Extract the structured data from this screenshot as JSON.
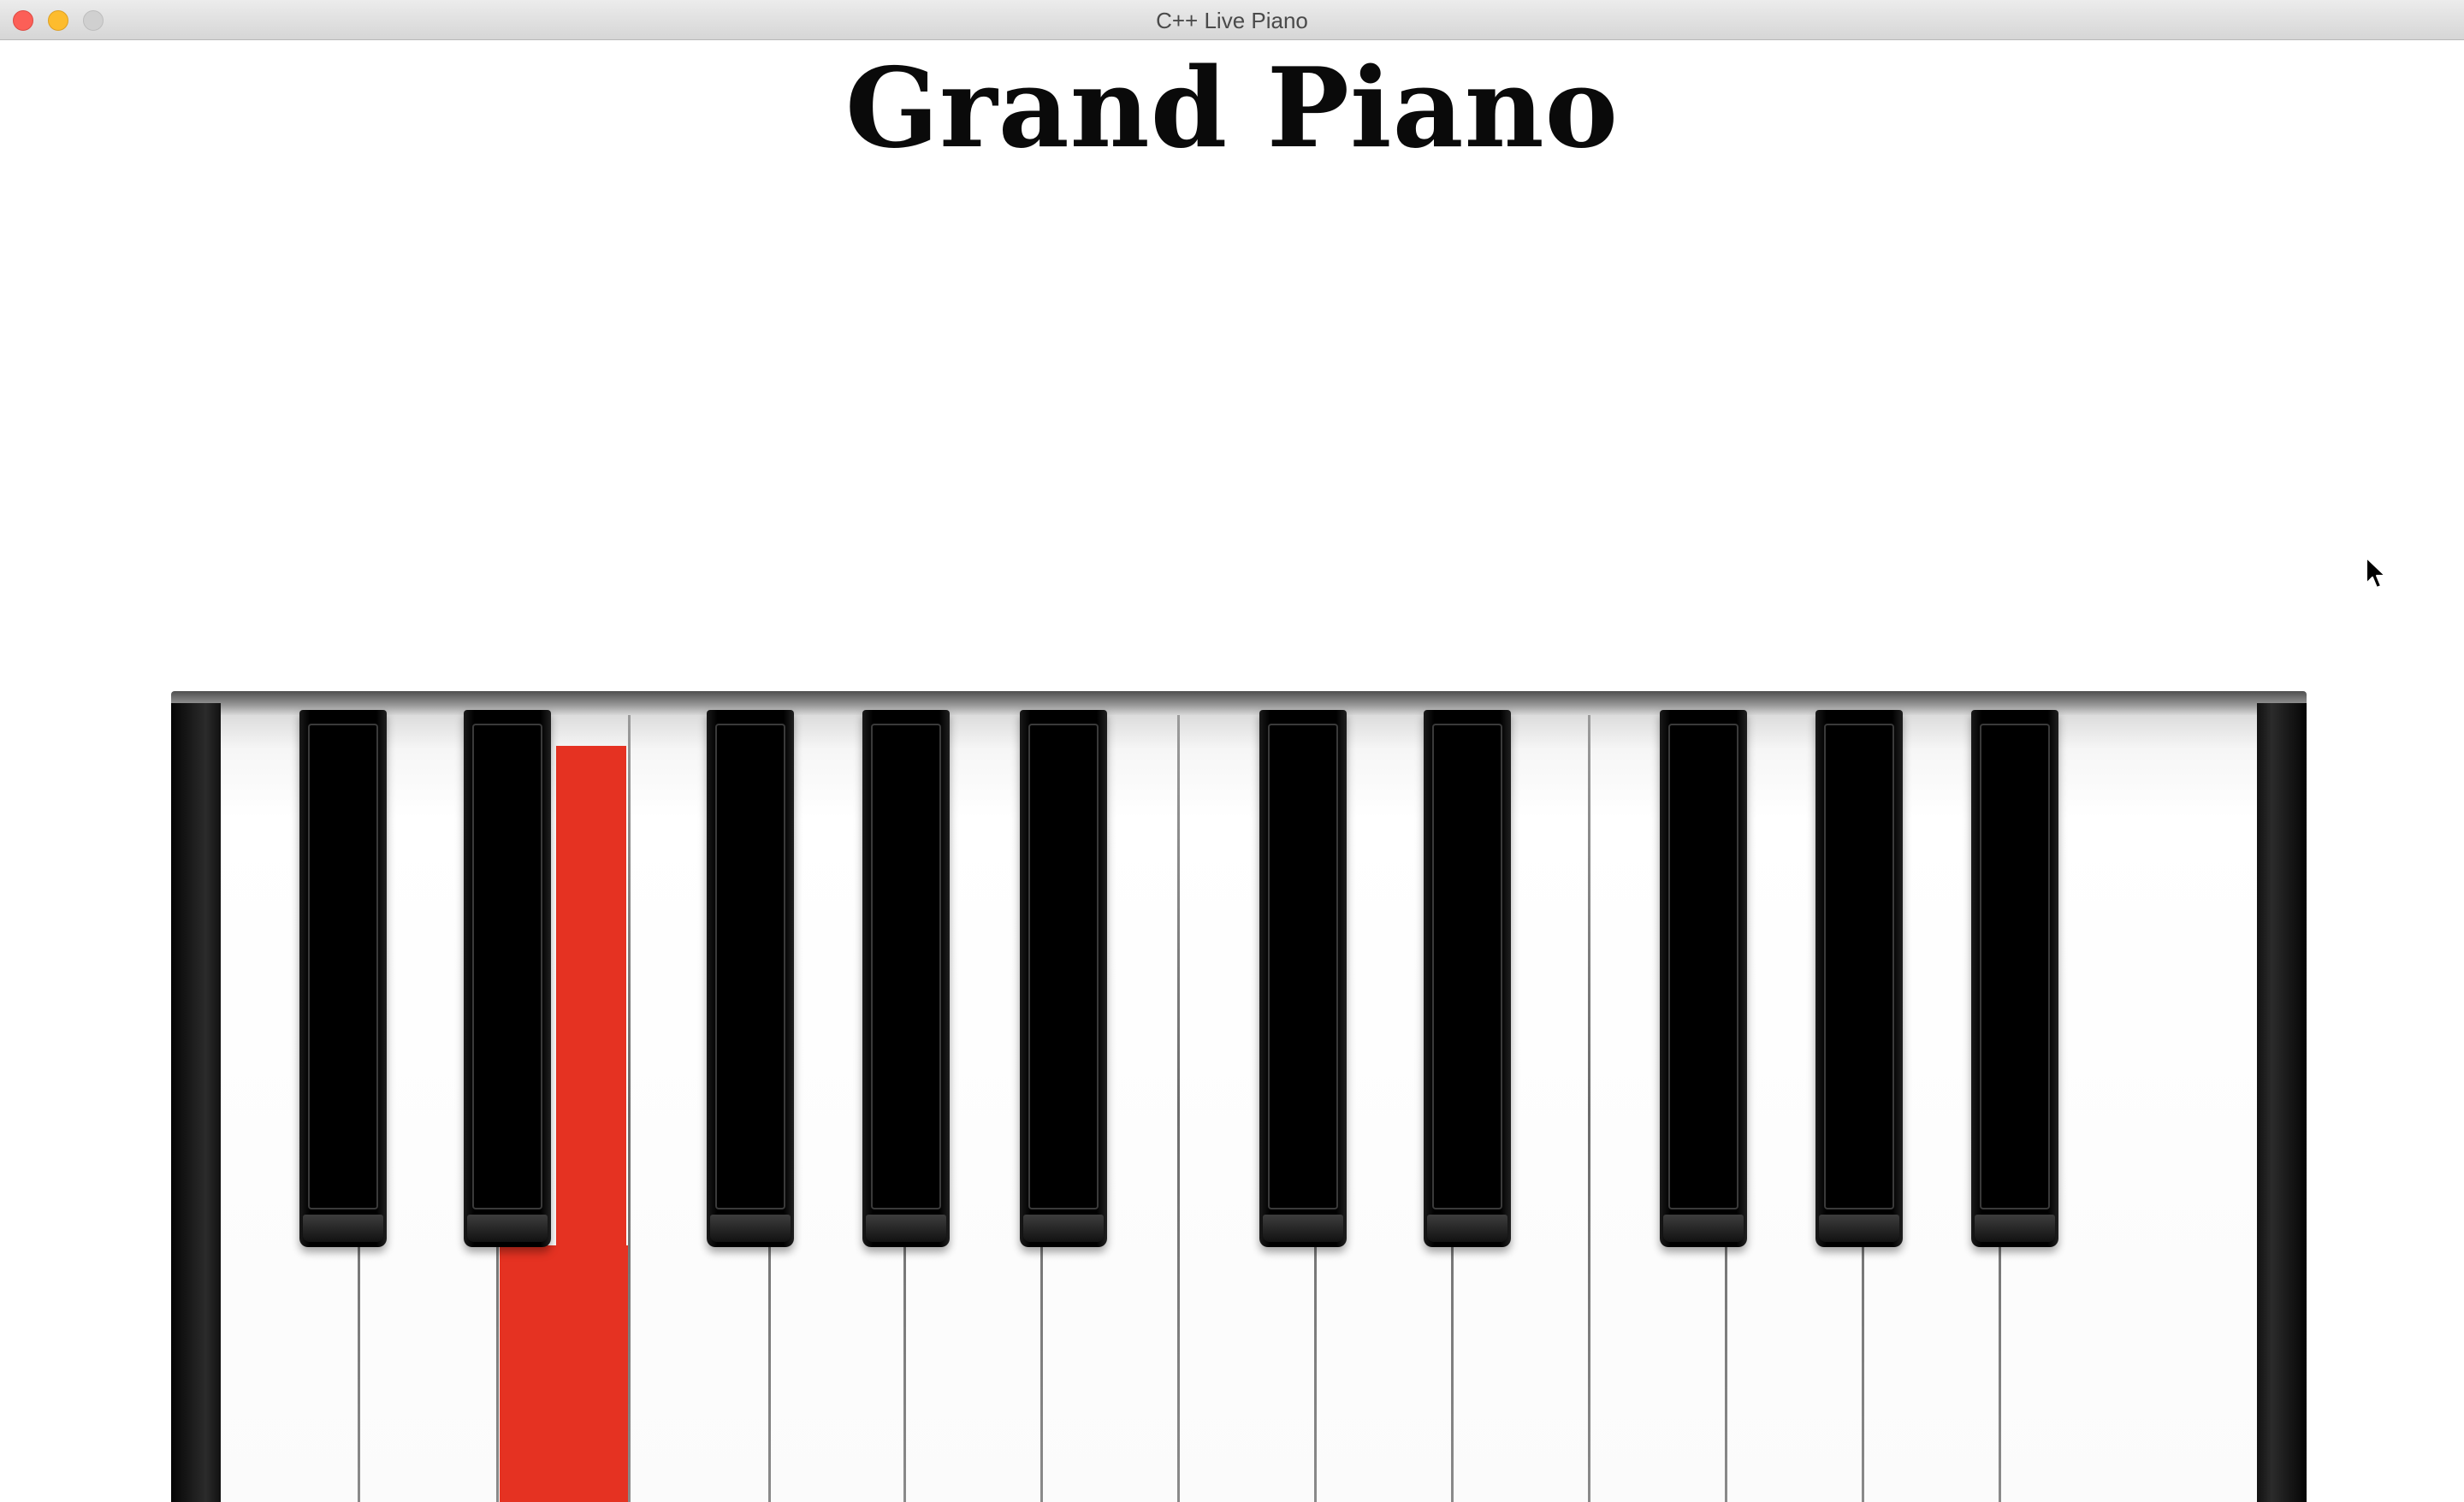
{
  "window": {
    "title": "C++ Live Piano",
    "controls": [
      "close",
      "minimize",
      "zoom"
    ]
  },
  "page": {
    "heading": "Grand Piano"
  },
  "keyboard": {
    "visible_white_keys": 14,
    "visible_black_keys": 10,
    "pressed_key": "E",
    "pressed_color": "#e53222",
    "key_colors": {
      "white": "#ffffff",
      "black": "#000000"
    }
  },
  "icons": [
    "close-icon",
    "minimize-icon",
    "zoom-icon",
    "mouse-pointer-icon"
  ]
}
